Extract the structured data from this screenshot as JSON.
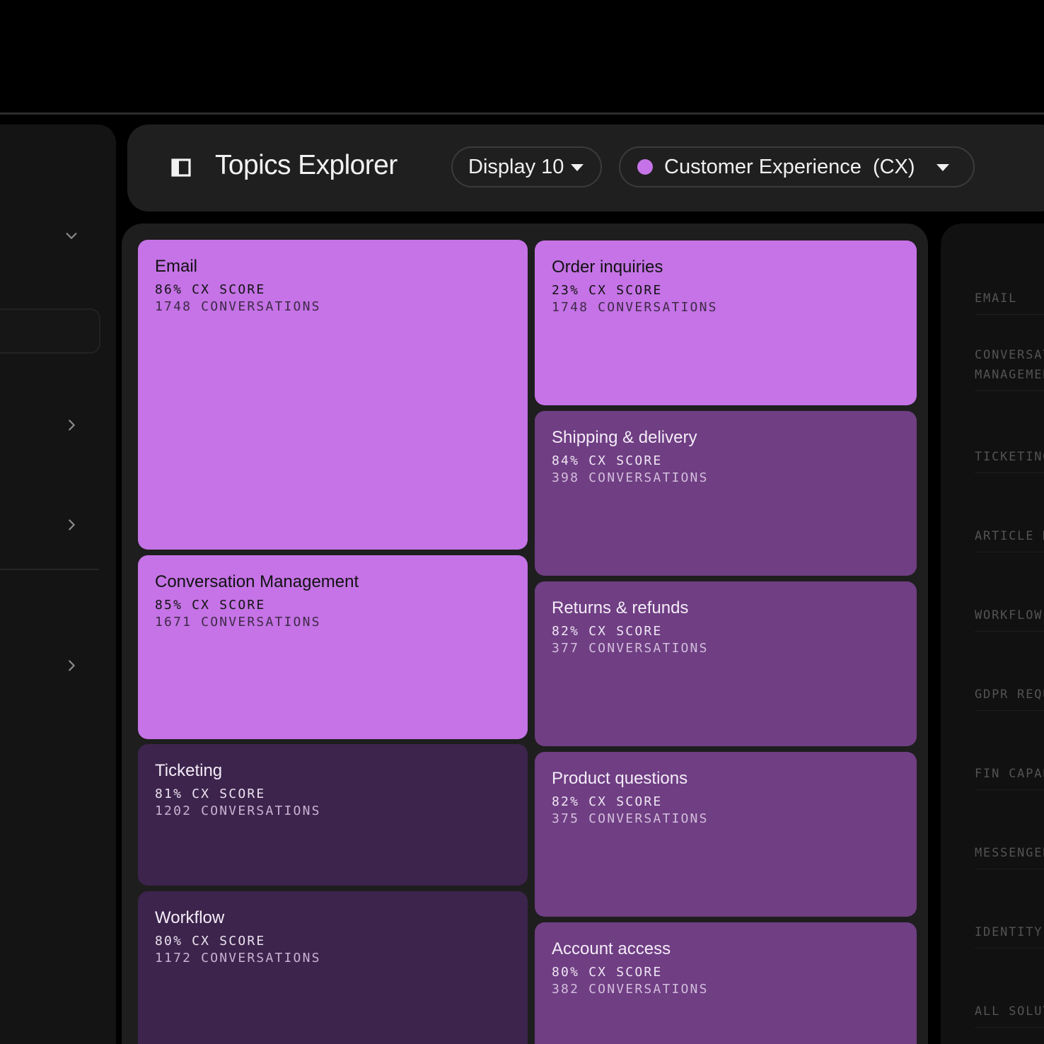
{
  "header": {
    "title": "Topics Explorer",
    "display_label": "Display 10",
    "segment_label": "Customer Experience  (CX)",
    "segment_color": "#c573e6",
    "panel_icon": "sidebar-toggle-icon"
  },
  "topics": [
    {
      "name": "Email",
      "score": "86% CX SCORE",
      "conversations": "1748 CONVERSATIONS"
    },
    {
      "name": "Conversation Management",
      "score": "85% CX SCORE",
      "conversations": "1671 CONVERSATIONS"
    },
    {
      "name": "Ticketing",
      "score": "81% CX SCORE",
      "conversations": "1202 CONVERSATIONS"
    },
    {
      "name": "Workflow",
      "score": "80% CX SCORE",
      "conversations": "1172 CONVERSATIONS"
    },
    {
      "name": "Order inquiries",
      "score": "23% CX SCORE",
      "conversations": "1748 CONVERSATIONS"
    },
    {
      "name": "Shipping & delivery",
      "score": "84% CX SCORE",
      "conversations": "398 CONVERSATIONS"
    },
    {
      "name": "Returns & refunds",
      "score": "82% CX SCORE",
      "conversations": "377 CONVERSATIONS"
    },
    {
      "name": "Product questions",
      "score": "82% CX SCORE",
      "conversations": "375 CONVERSATIONS"
    },
    {
      "name": "Account access",
      "score": "80% CX SCORE",
      "conversations": "382 CONVERSATIONS"
    }
  ],
  "legend": [
    "EMAIL",
    "CONVERSATION\nMANAGEMENT",
    "TICKETING",
    "ARTICLE M",
    "WORKFLOW",
    "GDPR REQU",
    "FIN CAPAB",
    "MESSENGER",
    "IDENTITY",
    "ALL SOLUT"
  ],
  "colors": {
    "tile_light": "#c573e6",
    "tile_mid": "#6f3e83",
    "tile_dark": "#3c244c",
    "background": "#000000"
  }
}
